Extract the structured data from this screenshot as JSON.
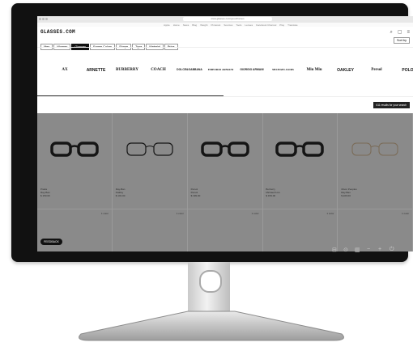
{
  "browser": {
    "url": "www.glasses.com/gl-us/frames"
  },
  "topnav": {
    "links": [
      "Apple",
      "Home",
      "News",
      "Blog",
      "Weight",
      "Pinterest",
      "Sources",
      "Tools",
      "Lenses",
      "Facebook Channel",
      "Play",
      "Translate"
    ]
  },
  "site": {
    "logo": "GLASSES.COM",
    "sort_label": "Sort by"
  },
  "filters": [
    {
      "label": "Men",
      "active": false
    },
    {
      "label": "Women",
      "active": false
    },
    {
      "label": "Glasses",
      "active": true
    },
    {
      "label": "Frame Colors",
      "active": false
    },
    {
      "label": "Shape",
      "active": false
    },
    {
      "label": "Type",
      "active": false
    },
    {
      "label": "Material",
      "active": false
    },
    {
      "label": "Price",
      "active": false
    }
  ],
  "brands": [
    "AX",
    "ARNETTE",
    "BURBERRY",
    "COACH",
    "DOLCE&GABBANA",
    "EMPORIO ARMANI",
    "GIORGIO ARMANI",
    "MICHAEL KORS",
    "Miu Miu",
    "OAKLEY",
    "Persol",
    "POLO"
  ],
  "results_label": "611 results for your search",
  "products": [
    {
      "brand": "Prada",
      "name": "Ray-Ban",
      "price": "$ 150.00",
      "style": "thick"
    },
    {
      "brand": "Ray-Ban",
      "name": "Oakley",
      "price": "$ 101.00",
      "style": "thin"
    },
    {
      "brand": "Persol",
      "name": "Persol",
      "price": "$ 199.00",
      "style": "thick"
    },
    {
      "brand": "Burberry",
      "name": "Michael Kors",
      "price": "$ 159.00",
      "style": "thick"
    },
    {
      "brand": "Oliver Peoples",
      "name": "Ray-Ban",
      "price": "$ 220.00",
      "style": "metal"
    }
  ],
  "row2_labels": [
    "1 color",
    "1 color",
    "1 color",
    "1 color",
    "1 color"
  ],
  "feedback_label": "FEEDBACK",
  "colors": {
    "bezel": "#111111",
    "overlay": "#8a8a8a",
    "accent": "#111111"
  }
}
